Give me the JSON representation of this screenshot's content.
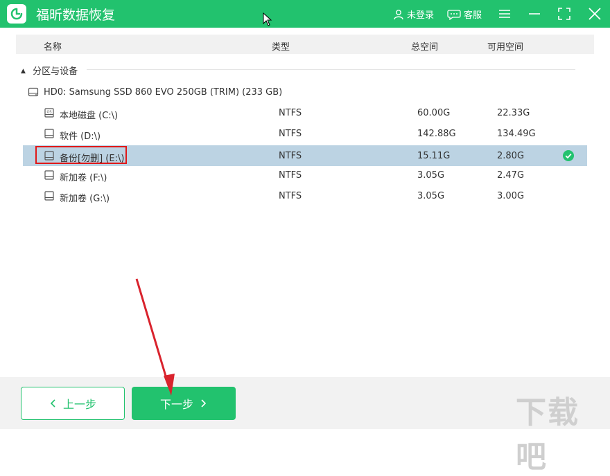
{
  "window": {
    "title": "福昕数据恢复",
    "login": "未登录",
    "service": "客服"
  },
  "table": {
    "headers": {
      "name": "名称",
      "type": "类型",
      "total": "总空间",
      "free": "可用空间"
    }
  },
  "section": {
    "title": "分区与设备"
  },
  "disk": {
    "label": "HD0: Samsung SSD 860 EVO 250GB (TRIM) (233 GB)"
  },
  "partitions": [
    {
      "name": "本地磁盘 (C:\\)",
      "fs": "NTFS",
      "total": "60.00G",
      "free": "22.33G",
      "icon": "os-drive-icon"
    },
    {
      "name": "软件 (D:\\)",
      "fs": "NTFS",
      "total": "142.88G",
      "free": "134.49G",
      "icon": "drive-icon"
    },
    {
      "name": "备份[勿删] (E:\\)",
      "fs": "NTFS",
      "total": "15.11G",
      "free": "2.80G",
      "icon": "drive-icon",
      "selected": true
    },
    {
      "name": "新加卷 (F:\\)",
      "fs": "NTFS",
      "total": "3.05G",
      "free": "2.47G",
      "icon": "drive-icon"
    },
    {
      "name": "新加卷 (G:\\)",
      "fs": "NTFS",
      "total": "3.05G",
      "free": "3.00G",
      "icon": "drive-icon"
    }
  ],
  "footer": {
    "prev": "上一步",
    "next": "下一步"
  },
  "watermark": "下载吧",
  "colors": {
    "accent": "#22c26e",
    "selected_row": "#bcd3e3",
    "highlight": "#e01818"
  }
}
